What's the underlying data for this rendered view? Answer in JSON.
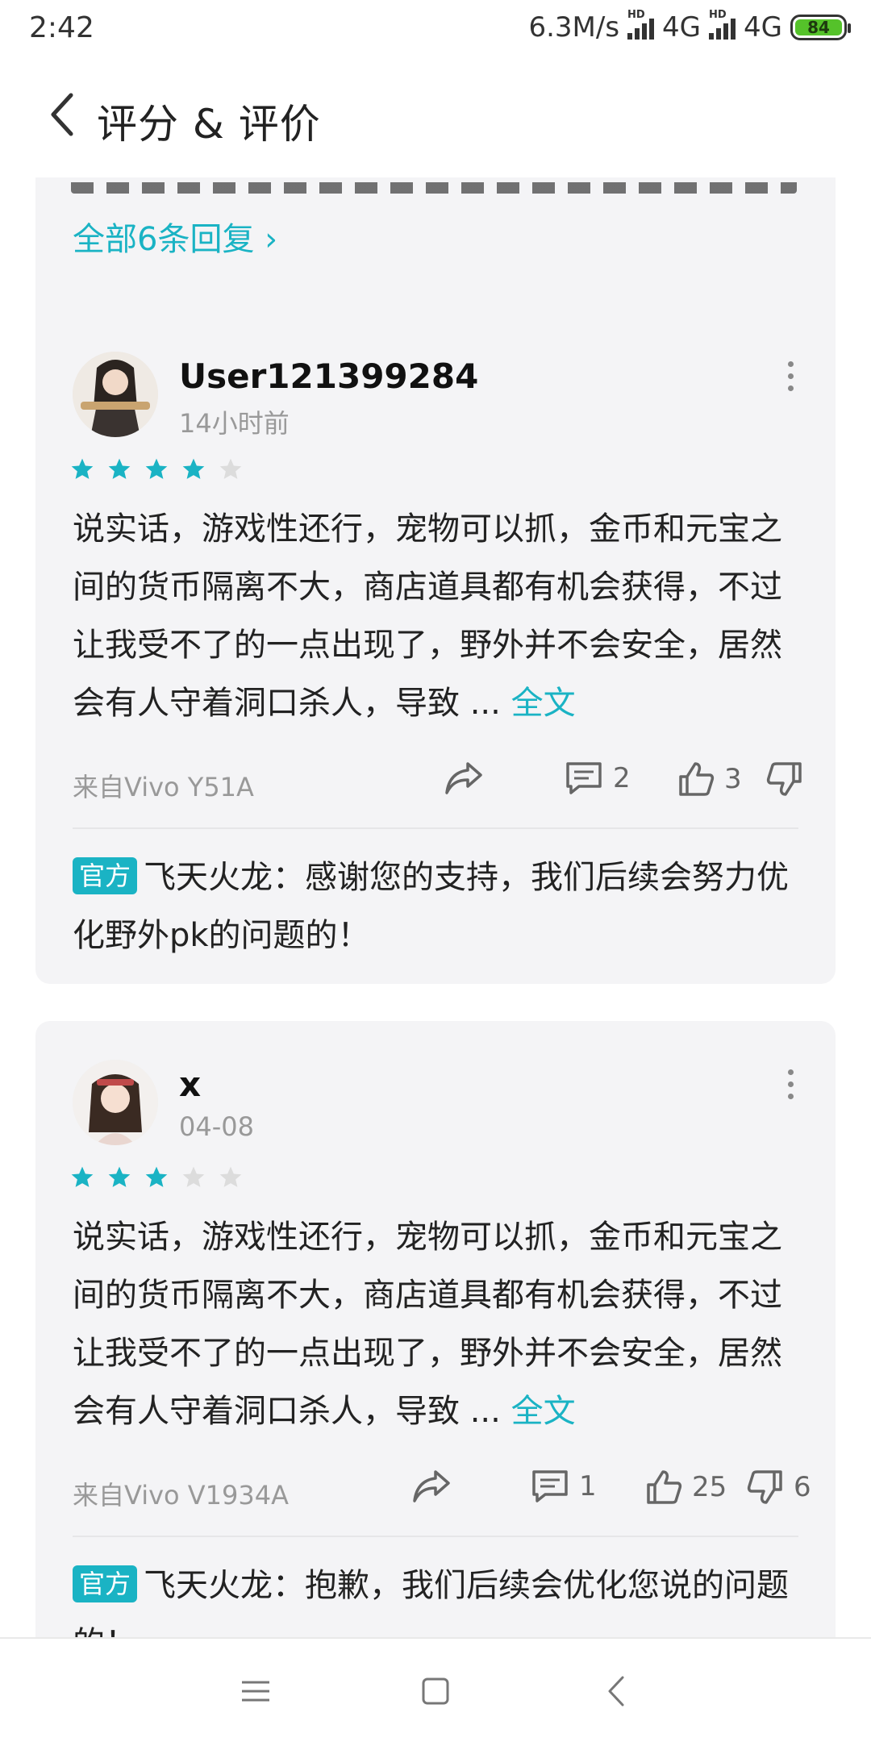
{
  "status_bar": {
    "time": "2:42",
    "speed": "6.3M/s",
    "network1": "4G",
    "network2": "4G",
    "battery": "84"
  },
  "header": {
    "title": "评分 & 评价"
  },
  "top_card": {
    "replies_link": "全部6条回复 ›"
  },
  "reviews": [
    {
      "username": "User121399284",
      "time": "14小时前",
      "rating": 4,
      "text": "说实话，游戏性还行，宠物可以抓，金币和元宝之间的货币隔离不大，商店道具都有机会获得，不过让我受不了的一点出现了，野外并不会安全，居然会有人守着洞口杀人，导致 ...",
      "full_text_link": "全文",
      "device": "来自Vivo Y51A",
      "comments": "2",
      "likes": "3",
      "dislikes": "",
      "official_badge": "官方",
      "official_reply": "飞天火龙：感谢您的支持，我们后续会努力优化野外pk的问题的！"
    },
    {
      "username": "x",
      "time": "04-08",
      "rating": 3,
      "text": "说实话，游戏性还行，宠物可以抓，金币和元宝之间的货币隔离不大，商店道具都有机会获得，不过让我受不了的一点出现了，野外并不会安全，居然会有人守着洞口杀人，导致 ...",
      "full_text_link": "全文",
      "device": "来自Vivo V1934A",
      "comments": "1",
      "likes": "25",
      "dislikes": "6",
      "official_badge": "官方",
      "official_reply": "飞天火龙：抱歉，我们后续会优化您说的问题的！"
    }
  ],
  "colors": {
    "accent": "#1ab3c4",
    "card_bg": "#f4f4f6",
    "star_empty": "#dcdcdc"
  },
  "icons": [
    "back-icon",
    "more-icon",
    "star-icon",
    "share-icon",
    "comment-icon",
    "like-icon",
    "dislike-icon",
    "menu-icon",
    "home-icon",
    "back-nav-icon"
  ]
}
